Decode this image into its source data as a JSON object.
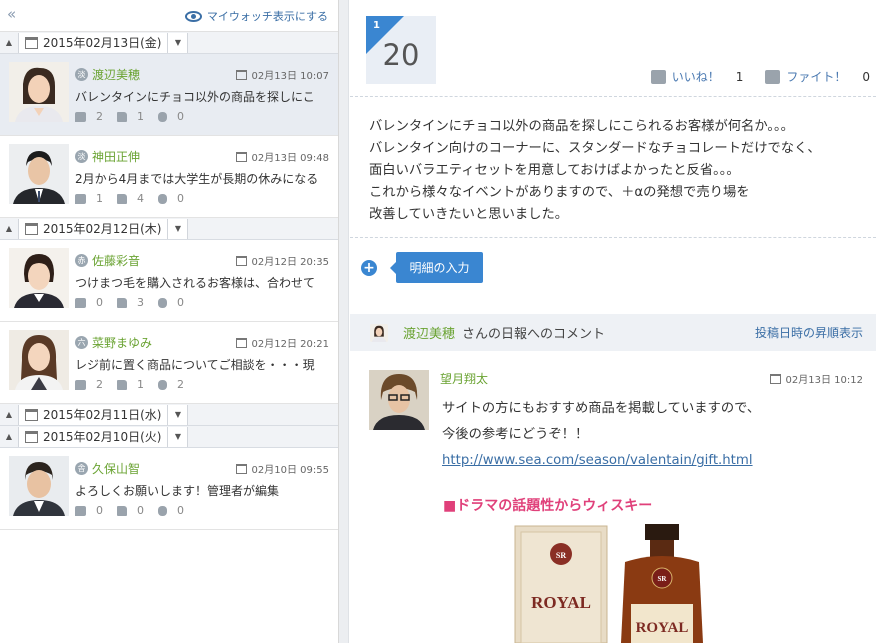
{
  "sidebar": {
    "watch_label": "マイウォッチ表示にする",
    "groups": [
      {
        "date": "2015年02月13日(金)",
        "entries": [
          {
            "name": "渡辺美穂",
            "badge": "淡",
            "time": "02月13日 10:07",
            "title": "バレンタインにチョコ以外の商品を探しにこ",
            "comments": "2",
            "likes": "1",
            "fights": "0"
          },
          {
            "name": "神田正伸",
            "badge": "淡",
            "time": "02月13日 09:48",
            "title": "2月から4月までは大学生が長期の休みになる",
            "comments": "1",
            "likes": "4",
            "fights": "0"
          }
        ]
      },
      {
        "date": "2015年02月12日(木)",
        "entries": [
          {
            "name": "佐藤彩音",
            "badge": "赤",
            "time": "02月12日 20:35",
            "title": "つけまつ毛を購入されるお客様は、合わせて",
            "comments": "0",
            "likes": "3",
            "fights": "0"
          },
          {
            "name": "菜野まゆみ",
            "badge": "六",
            "time": "02月12日 20:21",
            "title": "レジ前に置く商品についてご相談を・・・現",
            "comments": "2",
            "likes": "1",
            "fights": "2"
          }
        ]
      },
      {
        "date": "2015年02月11日(水)",
        "entries": []
      },
      {
        "date": "2015年02月10日(火)",
        "entries": [
          {
            "name": "久保山智",
            "badge": "舎",
            "time": "02月10日 09:55",
            "title": "よろしくお願いします！管理者が編集",
            "comments": "0",
            "likes": "0",
            "fights": "0"
          }
        ]
      }
    ]
  },
  "report": {
    "day_small": "1",
    "day_big": "20",
    "like_label": "いいね！",
    "like_count": "1",
    "fight_label": "ファイト！",
    "fight_count": "0",
    "body_lines": [
      "バレンタインにチョコ以外の商品を探しにこられるお客様が何名か。。。",
      "バレンタイン向けのコーナーに、スタンダードなチョコレートだけでなく、",
      "面白いバラエティセットを用意しておけばよかったと反省。。。",
      "これから様々なイベントがありますので、＋αの発想で売り場を",
      "改善していきたいと思いました。"
    ],
    "detail_button": "明細の入力"
  },
  "comments_section": {
    "author": "渡辺美穂",
    "header_text": "さんの日報へのコメント",
    "sort_label": "投稿日時の昇順表示",
    "comment": {
      "name": "望月翔太",
      "time": "02月13日 10:12",
      "lines": [
        "サイトの方にもおすすめ商品を掲載していますので、",
        "今後の参考にどうぞ！！"
      ],
      "link": "http://www.sea.com/season/valentain/gift.html",
      "promo": "■ドラマの話題性からウィスキー"
    }
  },
  "product_label": "ROYAL",
  "product_badge": "SR"
}
